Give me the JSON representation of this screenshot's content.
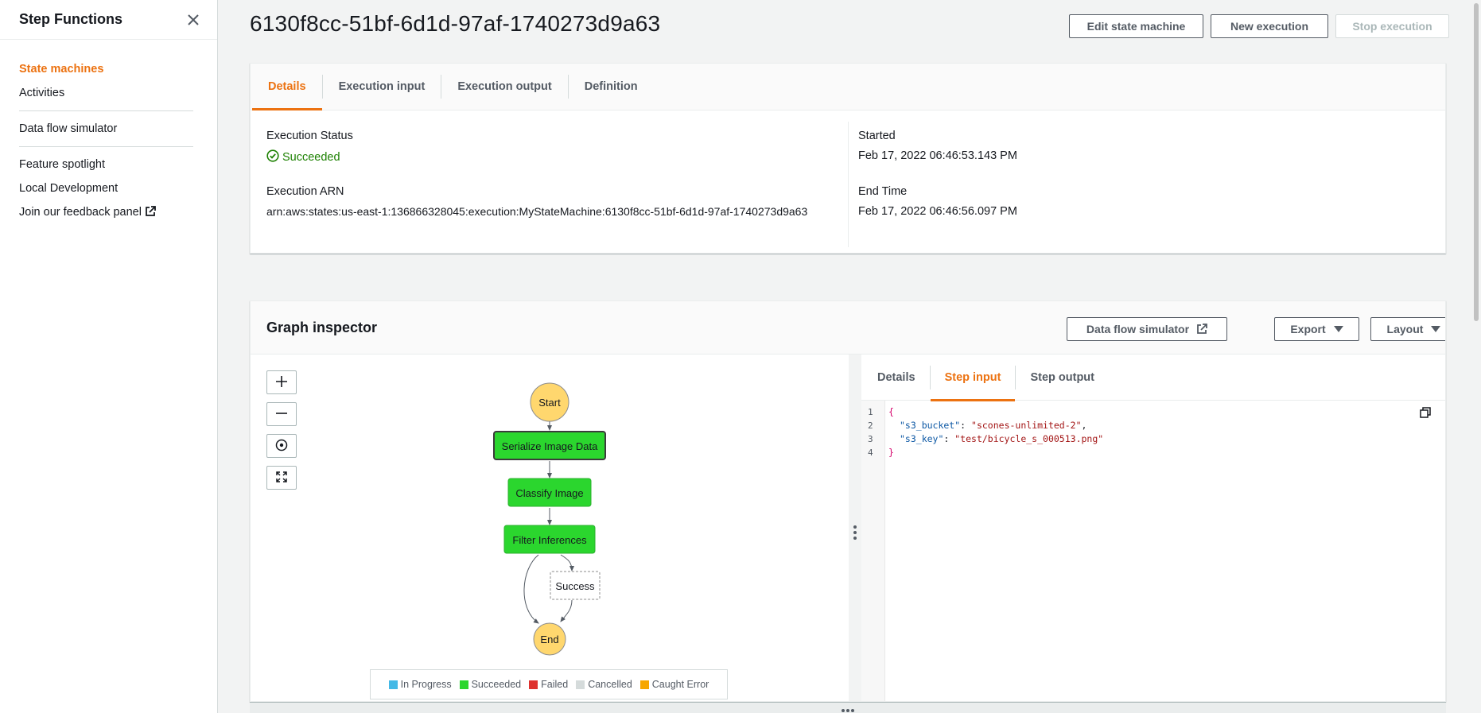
{
  "sidebar": {
    "title": "Step Functions",
    "items": [
      {
        "label": "State machines"
      },
      {
        "label": "Activities"
      },
      {
        "label": "Data flow simulator"
      },
      {
        "label": "Feature spotlight"
      },
      {
        "label": "Local Development"
      },
      {
        "label": "Join our feedback panel"
      }
    ]
  },
  "header": {
    "title": "6130f8cc-51bf-6d1d-97af-1740273d9a63",
    "edit_label": "Edit state machine",
    "new_label": "New execution",
    "stop_label": "Stop execution"
  },
  "details": {
    "tabs": [
      "Details",
      "Execution input",
      "Execution output",
      "Definition"
    ],
    "status_label": "Execution Status",
    "status_value": "Succeeded",
    "arn_label": "Execution ARN",
    "arn_value": "arn:aws:states:us-east-1:136866328045:execution:MyStateMachine:6130f8cc-51bf-6d1d-97af-1740273d9a63",
    "started_label": "Started",
    "started_value": "Feb 17, 2022 06:46:53.143 PM",
    "end_label": "End Time",
    "end_value": "Feb 17, 2022 06:46:56.097 PM"
  },
  "graph": {
    "title": "Graph inspector",
    "simulator_label": "Data flow simulator",
    "export_label": "Export",
    "layout_label": "Layout",
    "nodes": {
      "start": "Start",
      "serialize": "Serialize Image Data",
      "classify": "Classify Image",
      "filter": "Filter Inferences",
      "success": "Success",
      "end": "End"
    },
    "legend": [
      {
        "label": "In Progress",
        "color": "#44b9e6"
      },
      {
        "label": "Succeeded",
        "color": "#2bd62e"
      },
      {
        "label": "Failed",
        "color": "#de322f"
      },
      {
        "label": "Cancelled",
        "color": "#d5dbdb"
      },
      {
        "label": "Caught Error",
        "color": "#f7a700"
      }
    ],
    "colors": {
      "succeeded": "#2bd62e",
      "terminal": "#ffd76e"
    }
  },
  "inspector": {
    "tabs": [
      "Details",
      "Step input",
      "Step output"
    ],
    "code": {
      "line_numbers": [
        "1",
        "2",
        "3",
        "4"
      ],
      "open": "{",
      "k1": "\"s3_bucket\"",
      "v1": "\"scones-unlimited-2\"",
      "k2": "\"s3_key\"",
      "v2": "\"test/bicycle_s_000513.png\"",
      "close": "}"
    }
  },
  "theme": {
    "accent": "#ec7211",
    "success": "#1d8102"
  }
}
